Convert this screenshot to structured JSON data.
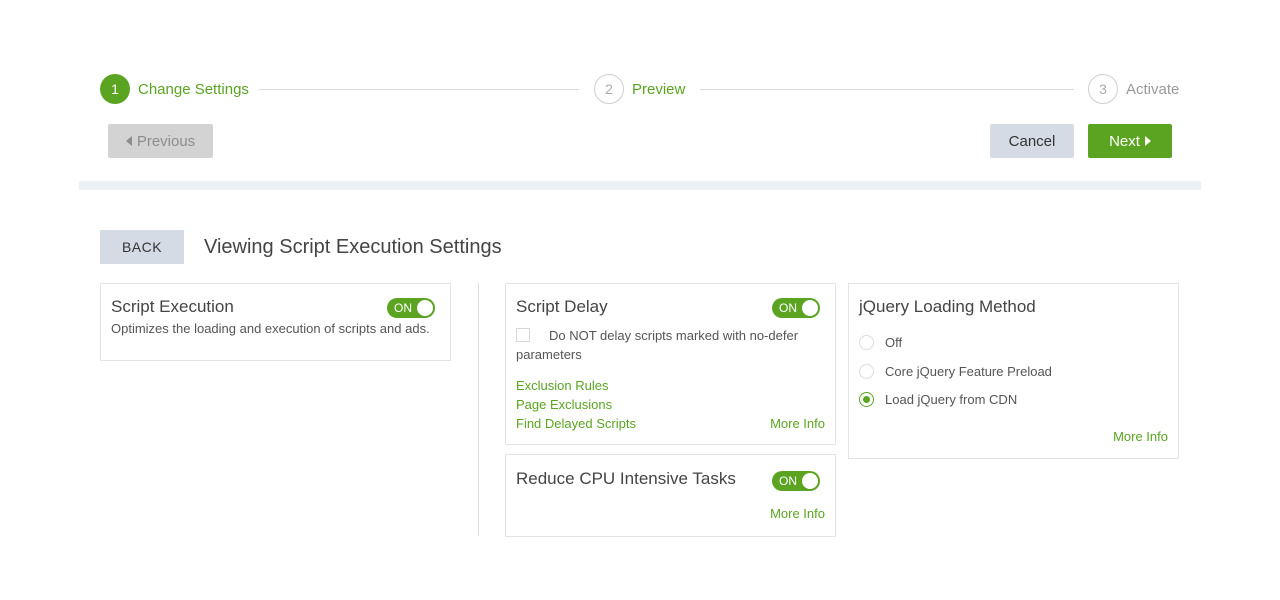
{
  "stepper": {
    "steps": [
      {
        "number": "1",
        "label": "Change Settings"
      },
      {
        "number": "2",
        "label": "Preview"
      },
      {
        "number": "3",
        "label": "Activate"
      }
    ]
  },
  "nav": {
    "previous_label": "Previous",
    "cancel_label": "Cancel",
    "next_label": "Next"
  },
  "header": {
    "back_label": "BACK",
    "title": "Viewing Script Execution Settings"
  },
  "script_execution": {
    "title": "Script Execution",
    "toggle": "ON",
    "description": "Optimizes the loading and execution of scripts and ads."
  },
  "script_delay": {
    "title": "Script Delay",
    "toggle": "ON",
    "checkbox_label_line1": "Do NOT delay scripts marked with no-defer",
    "checkbox_label_line2": "parameters",
    "links": [
      "Exclusion Rules",
      "Page Exclusions",
      "Find Delayed Scripts"
    ],
    "more_info": "More Info"
  },
  "reduce_cpu": {
    "title": "Reduce CPU Intensive Tasks",
    "toggle": "ON",
    "more_info": "More Info"
  },
  "jquery": {
    "title": "jQuery Loading Method",
    "options": [
      "Off",
      "Core jQuery Feature Preload",
      "Load jQuery from CDN"
    ],
    "selected": "Load jQuery from CDN",
    "more_info": "More Info"
  },
  "colors": {
    "accent": "#5ba422",
    "button_grey": "#d4dbe5"
  }
}
